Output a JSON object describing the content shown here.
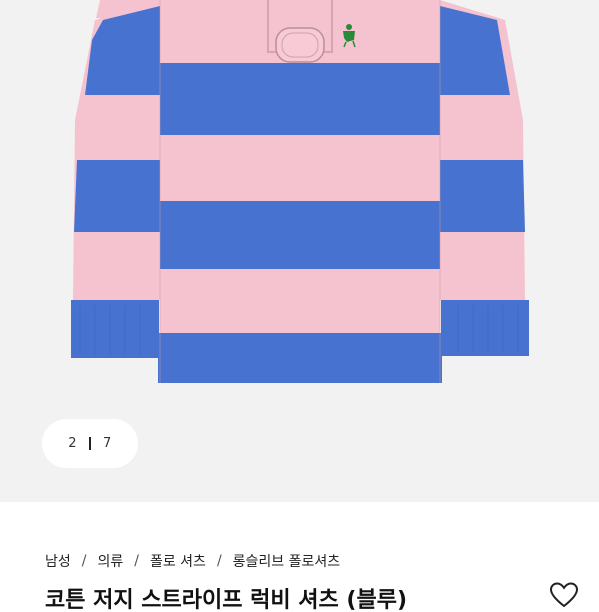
{
  "gallery": {
    "current_page": "2",
    "total_pages": "7",
    "colors": {
      "pink": "#f5c2cf",
      "blue": "#4872cf",
      "logo": "#2a8a3a",
      "background": "#f2f2f2"
    }
  },
  "breadcrumb": [
    "남성",
    "의류",
    "폴로 셔츠",
    "롱슬리브 폴로셔츠"
  ],
  "product": {
    "title": "코튼 저지 스트라이프 럭비 셔츠 (블루)"
  },
  "icons": {
    "favorite": "heart-outline-icon"
  }
}
